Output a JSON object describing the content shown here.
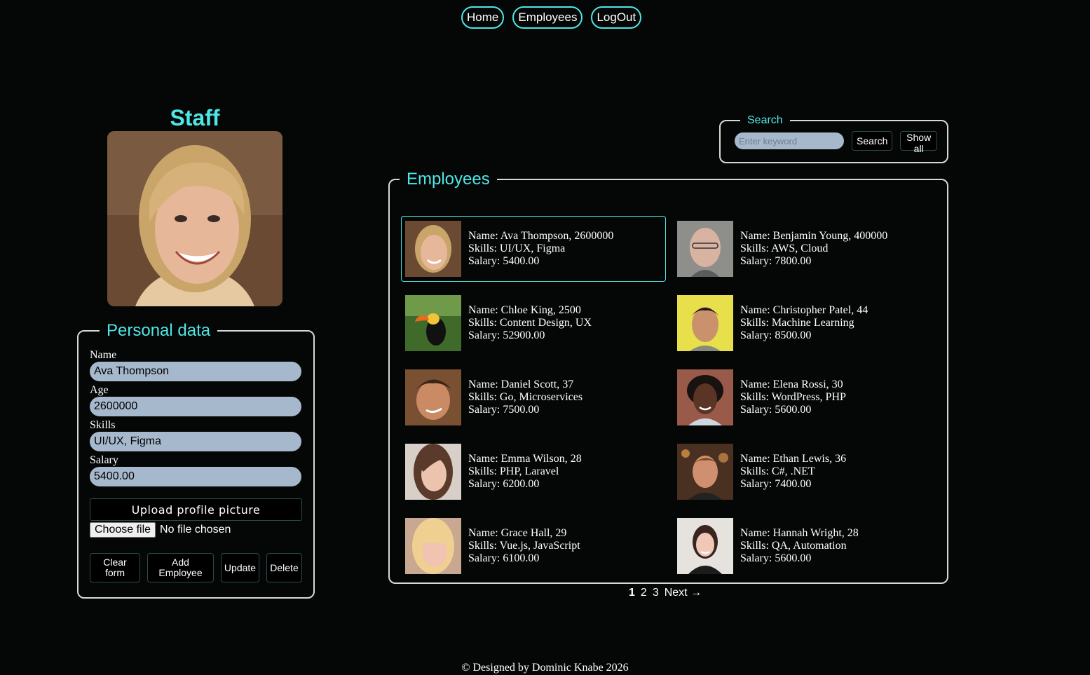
{
  "nav": {
    "home": "Home",
    "employees": "Employees",
    "logout": "LogOut"
  },
  "staff": {
    "title": "Staff"
  },
  "personal": {
    "legend": "Personal data",
    "name_label": "Name",
    "name_value": "Ava Thompson",
    "age_label": "Age",
    "age_value": "2600000",
    "skills_label": "Skills",
    "skills_value": "UI/UX, Figma",
    "salary_label": "Salary",
    "salary_value": "5400.00",
    "upload_label": "Upload profile picture",
    "choose_file": "Choose file",
    "no_file": "No file chosen",
    "clear_l1": "Clear",
    "clear_l2": "form",
    "add_l1": "Add",
    "add_l2": "Employee",
    "update": "Update",
    "delete": "Delete"
  },
  "search": {
    "legend": "Search",
    "placeholder": "Enter keyword",
    "search_btn": "Search",
    "show_all": "Show all"
  },
  "employees": {
    "legend": "Employees",
    "cards": [
      {
        "name": "Name: Ava Thompson, 2600000",
        "skills": "Skills: UI/UX, Figma",
        "salary": "Salary: 5400.00",
        "thumb": "woman-blonde"
      },
      {
        "name": "Name: Benjamin Young, 400000",
        "skills": "Skills: AWS, Cloud",
        "salary": "Salary: 7800.00",
        "thumb": "man-gray"
      },
      {
        "name": "Name: Chloe King, 2500",
        "skills": "Skills: Content Design, UX",
        "salary": "Salary: 52900.00",
        "thumb": "toucan-bird"
      },
      {
        "name": "Name: Christopher Patel, 44",
        "skills": "Skills: Machine Learning",
        "salary": "Salary: 8500.00",
        "thumb": "man-yellow"
      },
      {
        "name": "Name: Daniel Scott, 37",
        "skills": "Skills: Go, Microservices",
        "salary": "Salary: 7500.00",
        "thumb": "man-smiling"
      },
      {
        "name": "Name: Elena Rossi, 30",
        "skills": "Skills: WordPress, PHP",
        "salary": "Salary: 5600.00",
        "thumb": "woman-curly"
      },
      {
        "name": "Name: Emma Wilson, 28",
        "skills": "Skills: PHP, Laravel",
        "salary": "Salary: 6200.00",
        "thumb": "woman-brunette"
      },
      {
        "name": "Name: Ethan Lewis, 36",
        "skills": "Skills: C#, .NET",
        "salary": "Salary: 7400.00",
        "thumb": "man-lights"
      },
      {
        "name": "Name: Grace Hall, 29",
        "skills": "Skills: Vue.js, JavaScript",
        "salary": "Salary: 6100.00",
        "thumb": "woman-fringe"
      },
      {
        "name": "Name: Hannah Wright, 28",
        "skills": "Skills: QA, Automation",
        "salary": "Salary: 5600.00",
        "thumb": "woman-dark-hair"
      }
    ]
  },
  "pager": {
    "p1": "1",
    "p2": "2",
    "p3": "3",
    "next": "Next →"
  },
  "footer": "© Designed by Dominic Knabe 2026",
  "colors": {
    "accent": "#4fe6e6",
    "background": "#040706",
    "input_bg": "#a6b8cc"
  }
}
